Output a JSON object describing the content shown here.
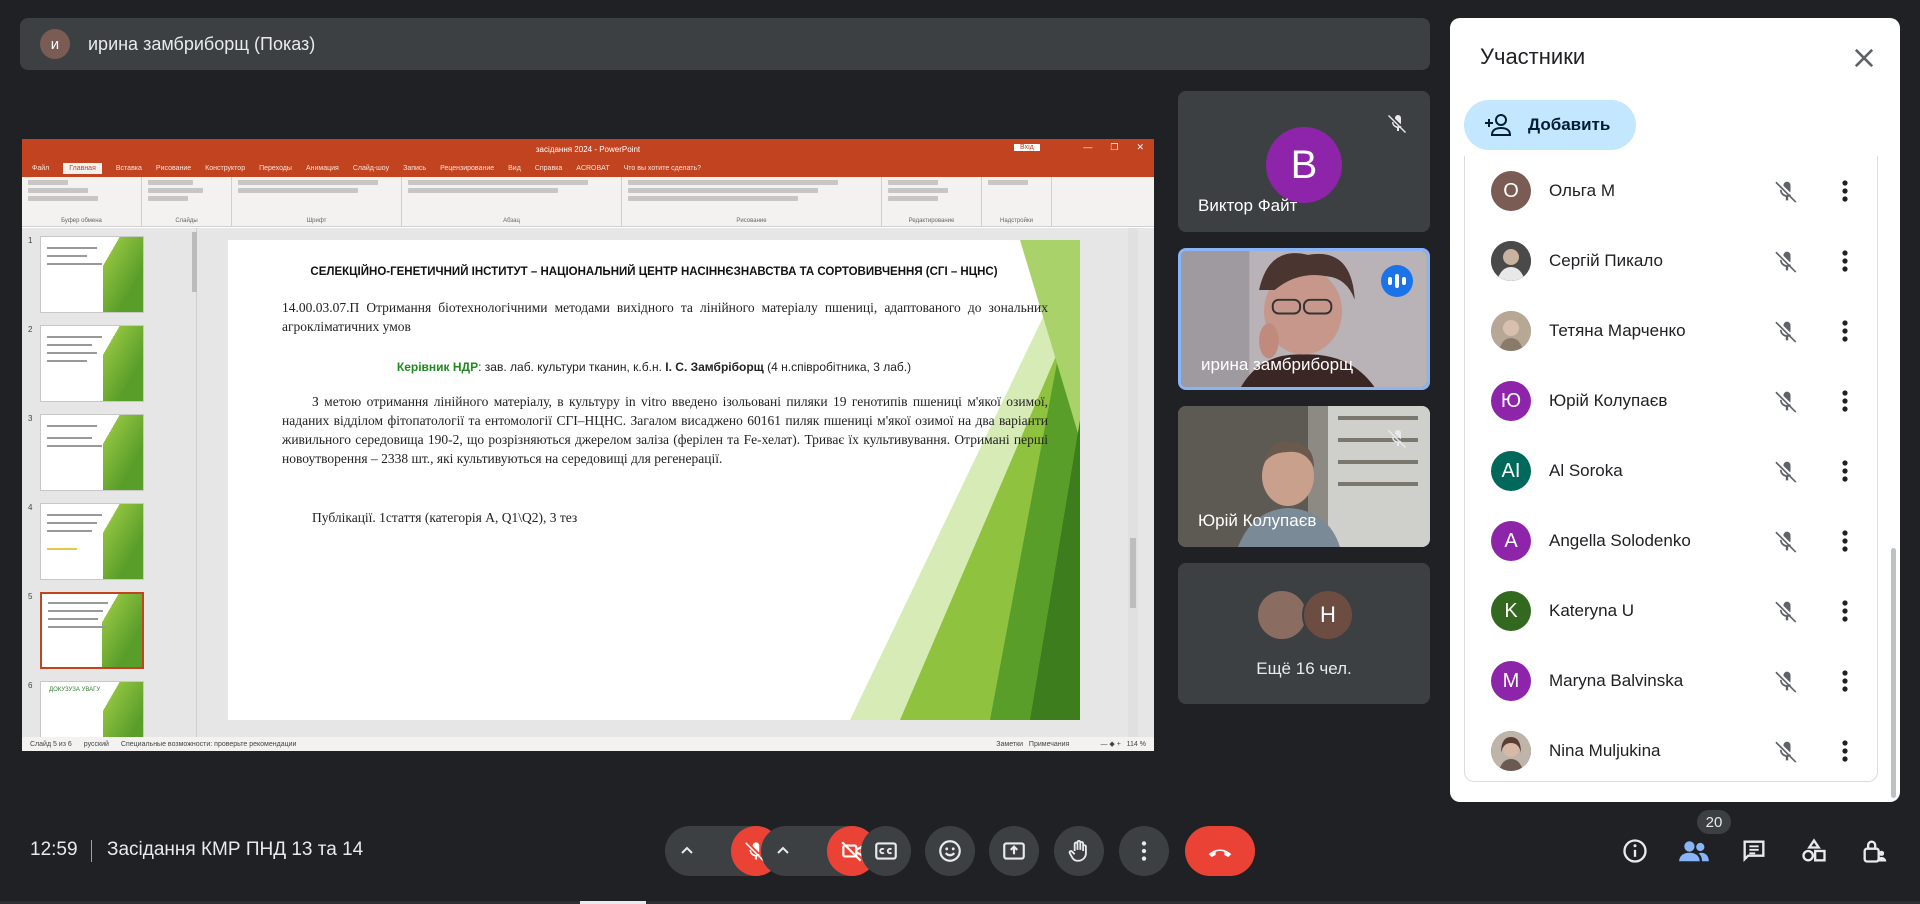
{
  "presenter": {
    "initial": "и",
    "label": "ирина замбриборщ (Показ)"
  },
  "presentation": {
    "window_title": "засідання 2024 - PowerPoint",
    "share_label": "Вхід",
    "tabs": [
      "Файл",
      "Главная",
      "Вставка",
      "Рисование",
      "Конструктор",
      "Переходы",
      "Анимация",
      "Слайд-шоу",
      "Запись",
      "Рецензирование",
      "Вид",
      "Справка",
      "ACROBAT",
      "Что вы хотите сделать?"
    ],
    "ribbon_groups": [
      "Буфер обмена",
      "Слайды",
      "Шрифт",
      "Абзац",
      "Рисование",
      "Редактирование",
      "Надстройки"
    ],
    "slide_numbers": [
      "1",
      "2",
      "3",
      "4",
      "5",
      "6"
    ],
    "thumb6_title": "ДОКУЗУЗА УВАГУ",
    "slide": {
      "title": "СЕЛЕКЦІЙНО-ГЕНЕТИЧНИЙ ІНСТИТУТ – НАЦІОНАЛЬНИЙ ЦЕНТР НАСІННЄЗНАВСТВА ТА СОРТОВИВЧЕННЯ (СГІ – НЦНС)",
      "topic": "14.00.03.07.П Отримання біотехнологічними методами вихідного та лінійного матеріалу пшениці, адаптованого до зональних агрокліматичних умов",
      "lead_label": "Керівник НДР",
      "lead_text": ": зав. лаб. культури тканин, к.б.н. ",
      "lead_name": "І. С. Замбріборщ",
      "lead_tail": " (4 н.співробітника, 3 лаб.)",
      "body": "З метою отримання лінійного матеріалу, в культуру in vitro введено ізольовані пиляки 19 генотипів пшениці м'якої озимої, наданих відділом фітопатології та ентомології СГІ–НЦНС. Загалом висаджено 60161 пиляк пшениці м'якої озимої на два варіанти живильного середовища 190-2, що розрізняються джерелом заліза (ферілен та Fe-хелат). Триває їх культивування. Отримані перші новоутворення – 2338 шт., які культивуються на середовищі для регенерації.",
      "publications": "Публікації. 1стаття (категорія А, Q1\\Q2), 3 тез"
    },
    "status": {
      "slide": "Слайд 5 из 6",
      "lang": "русский",
      "access": "Специальные возможности: проверьте рекомендации",
      "notes": "Заметки",
      "comments": "Примечания",
      "zoom": "114 %"
    }
  },
  "tiles": [
    {
      "name": "Виктор Файт",
      "initial": "В",
      "avatar_color": "#8e24aa"
    },
    {
      "name": "ирина замбриборщ"
    },
    {
      "name": "Юрій Колупаєв"
    },
    {
      "more_label": "Ещё 16 чел.",
      "initial": "Н"
    }
  ],
  "panel": {
    "title": "Участники",
    "add_label": "Добавить",
    "participants": [
      {
        "name": "Ольга М",
        "initial": "О",
        "color": "#7a5c55"
      },
      {
        "name": "Сергій Пикало",
        "initial": "",
        "color": "#5d5d5d"
      },
      {
        "name": "Тетяна Марченко",
        "initial": "",
        "color": "#a39283"
      },
      {
        "name": "Юрій Колупаєв",
        "initial": "Ю",
        "color": "#8e24aa"
      },
      {
        "name": "Al Soroka",
        "initial": "AI",
        "color": "#00695c"
      },
      {
        "name": "Angella Solodenko",
        "initial": "A",
        "color": "#8e24aa"
      },
      {
        "name": "Kateryna U",
        "initial": "K",
        "color": "#33691e"
      },
      {
        "name": "Maryna Balvinska",
        "initial": "M",
        "color": "#8e24aa"
      },
      {
        "name": "Nina Muljukina",
        "initial": "",
        "color": "#8d6e63"
      }
    ]
  },
  "bottom": {
    "time": "12:59",
    "meeting_name": "Засідання КМР ПНД 13 та 14",
    "participants_count": "20"
  }
}
